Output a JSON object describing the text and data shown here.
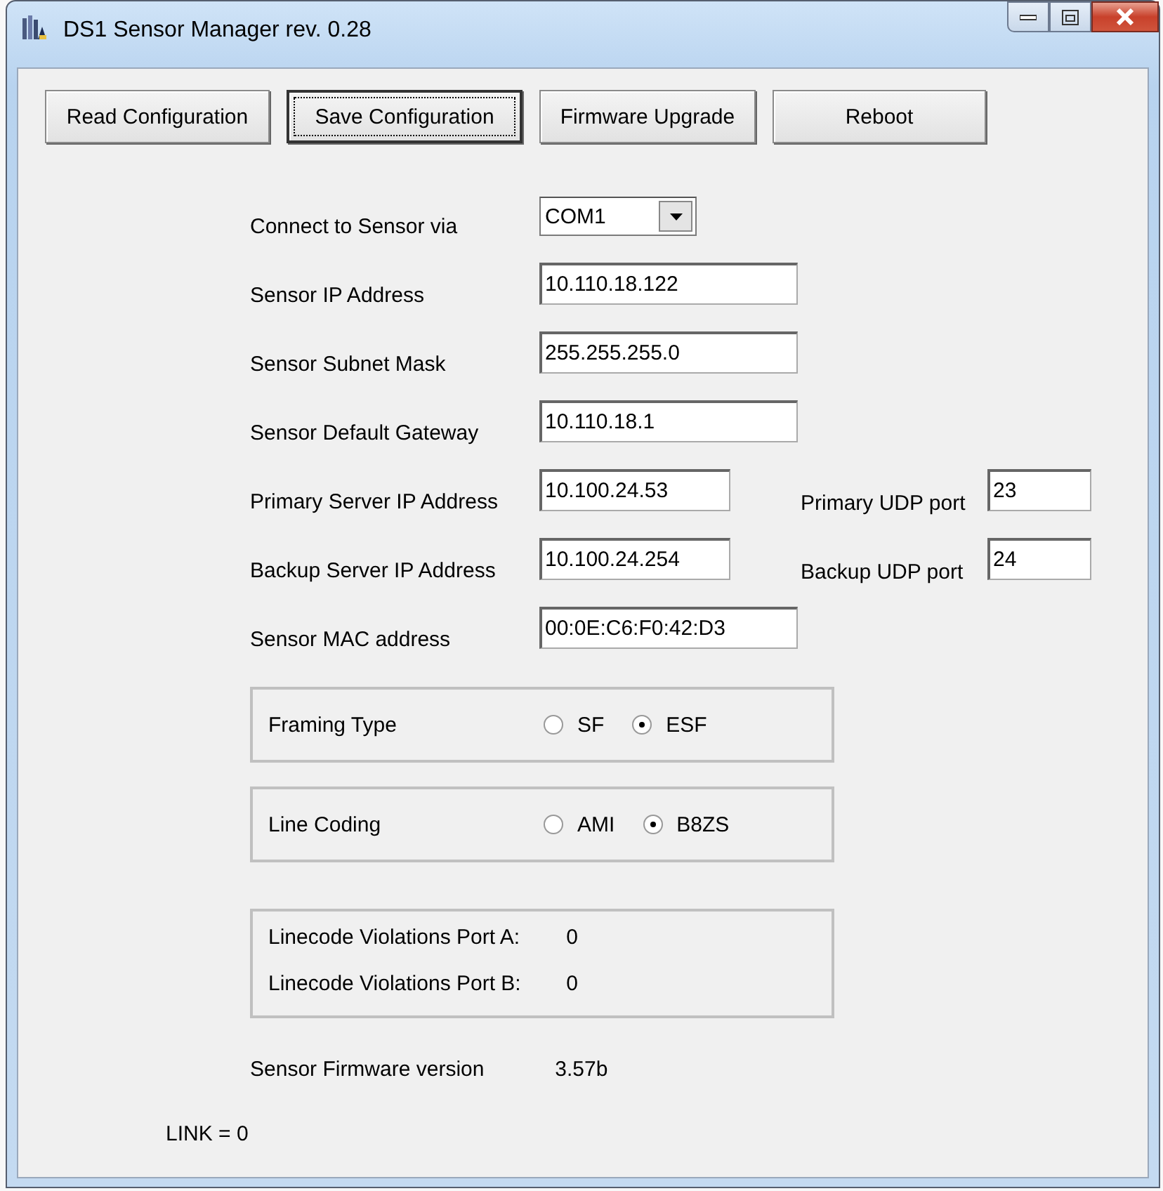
{
  "window": {
    "title": "DS1 Sensor Manager rev. 0.28"
  },
  "toolbar": [
    {
      "label": "Read Configuration",
      "focused": false
    },
    {
      "label": "Save Configuration",
      "focused": true
    },
    {
      "label": "Firmware Upgrade",
      "focused": false
    },
    {
      "label": "Reboot",
      "focused": false
    }
  ],
  "connection": {
    "label": "Connect to Sensor via",
    "value": "COM1"
  },
  "fields": [
    {
      "kind": "wide",
      "label": "Sensor IP Address",
      "value": "10.110.18.122"
    },
    {
      "kind": "wide",
      "label": "Sensor Subnet Mask",
      "value": "255.255.255.0"
    },
    {
      "kind": "wide",
      "label": "Sensor Default Gateway",
      "value": "10.110.18.1"
    },
    {
      "kind": "with_port",
      "label": "Primary Server IP Address",
      "value": "10.100.24.53",
      "port_label": "Primary UDP port",
      "port_value": "23"
    },
    {
      "kind": "with_port",
      "label": "Backup Server IP Address",
      "value": "10.100.24.254",
      "port_label": "Backup UDP port",
      "port_value": "24"
    },
    {
      "kind": "wide",
      "label": "Sensor MAC address",
      "value": "00:0E:C6:F0:42:D3"
    }
  ],
  "option_groups": [
    {
      "label": "Framing Type",
      "options": [
        {
          "label": "SF",
          "selected": false
        },
        {
          "label": "ESF",
          "selected": true
        }
      ]
    },
    {
      "label": "Line Coding",
      "options": [
        {
          "label": "AMI",
          "selected": false
        },
        {
          "label": "B8ZS",
          "selected": true
        }
      ]
    }
  ],
  "violations": [
    {
      "label": "Linecode Violations Port A:",
      "value": "0"
    },
    {
      "label": "Linecode Violations Port B:",
      "value": "0"
    }
  ],
  "firmware": {
    "label": "Sensor Firmware version",
    "value": "3.57b"
  },
  "link_status": "LINK = 0"
}
